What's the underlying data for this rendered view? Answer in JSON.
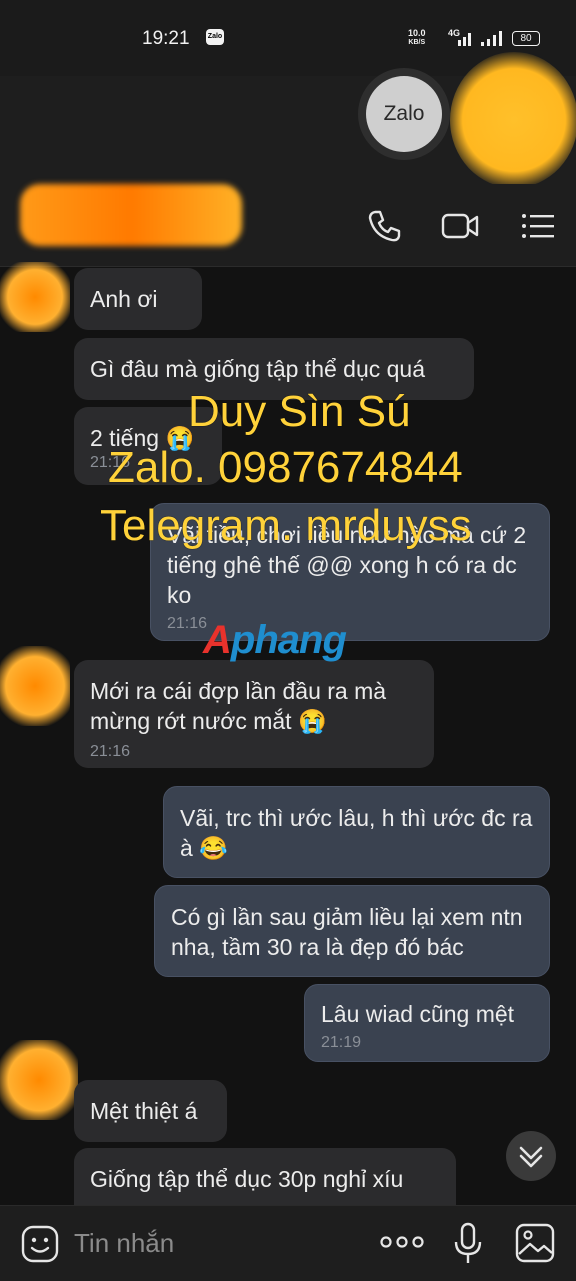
{
  "status_bar": {
    "time": "19:21",
    "app_badge": "Zalo",
    "net_speed": "10.0",
    "net_unit": "KB/S",
    "network": "4G",
    "battery": "80"
  },
  "floating_bubble": {
    "label": "Zalo"
  },
  "header": {
    "icons": [
      "phone-icon",
      "video-call-icon",
      "menu-icon"
    ]
  },
  "messages": [
    {
      "dir": "in",
      "text": "Anh ơi"
    },
    {
      "dir": "in",
      "text": "Gì đâu mà giống tập thể dục quá"
    },
    {
      "dir": "in",
      "text": "2 tiếng 😭",
      "time": "21:16"
    },
    {
      "dir": "out",
      "text": "Vãi tiều, chơi liều như nào mà cứ 2 tiếng ghê thế @@ xong h có ra dc ko",
      "time": "21:16"
    },
    {
      "dir": "in",
      "text": "Mới ra cái đợp lần đầu ra mà mừng rớt nước mắt 😭",
      "time": "21:16"
    },
    {
      "dir": "out",
      "text": "Vãi, trc thì ước lâu, h thì ước đc ra à 😂"
    },
    {
      "dir": "out",
      "text": "Có gì lần sau giảm liều lại xem ntn nha, tầm 30 ra là đẹp đó bác"
    },
    {
      "dir": "out",
      "text": "Lâu wiad cũng mệt",
      "time": "21:19"
    },
    {
      "dir": "in",
      "text": "Mệt thiệt á"
    },
    {
      "dir": "in",
      "text": "Giống tập thể dục 30p nghỉ xíu"
    }
  ],
  "watermark": {
    "line1": "Duy Sìn Sú",
    "line2": "Zalo. 0987674844",
    "line3": "Telegram. mrduyss",
    "brand_a": "A",
    "brand_rest": "phang"
  },
  "input": {
    "placeholder": "Tin nhắn"
  },
  "colors": {
    "background": "#121212",
    "incoming_bubble": "#2b2b2d",
    "outgoing_bubble": "#3a4250",
    "watermark": "#ffd23a"
  }
}
